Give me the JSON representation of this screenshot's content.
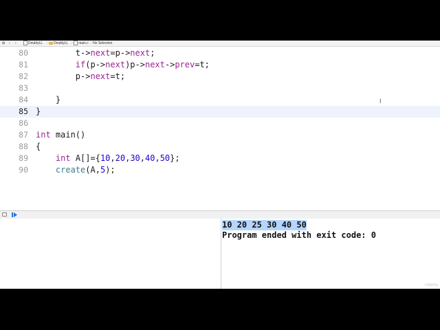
{
  "jumpbar": {
    "crumbs": [
      "DoublyLL",
      "DoublyLL",
      "main.c",
      "No Selection"
    ]
  },
  "editor": {
    "current_line": 85,
    "lines": [
      {
        "n": 80,
        "tokens": [
          [
            "plain",
            "        t->"
          ],
          [
            "kw",
            "next"
          ],
          [
            "plain",
            "=p->"
          ],
          [
            "kw",
            "next"
          ],
          [
            "plain",
            ";"
          ]
        ]
      },
      {
        "n": 81,
        "tokens": [
          [
            "plain",
            "        "
          ],
          [
            "kw",
            "if"
          ],
          [
            "plain",
            "(p->"
          ],
          [
            "kw",
            "next"
          ],
          [
            "plain",
            ")p->"
          ],
          [
            "kw",
            "next"
          ],
          [
            "plain",
            "->"
          ],
          [
            "kw",
            "prev"
          ],
          [
            "plain",
            "=t;"
          ]
        ]
      },
      {
        "n": 82,
        "tokens": [
          [
            "plain",
            "        p->"
          ],
          [
            "kw",
            "next"
          ],
          [
            "plain",
            "=t;"
          ]
        ]
      },
      {
        "n": 83,
        "tokens": []
      },
      {
        "n": 84,
        "tokens": [
          [
            "plain",
            "    }"
          ]
        ]
      },
      {
        "n": 85,
        "tokens": [
          [
            "plain",
            "}"
          ]
        ]
      },
      {
        "n": 86,
        "tokens": []
      },
      {
        "n": 87,
        "tokens": [
          [
            "kw",
            "int"
          ],
          [
            "plain",
            " main()"
          ]
        ]
      },
      {
        "n": 88,
        "tokens": [
          [
            "plain",
            "{"
          ]
        ]
      },
      {
        "n": 89,
        "tokens": [
          [
            "plain",
            "    "
          ],
          [
            "kw",
            "int"
          ],
          [
            "plain",
            " A[]={"
          ],
          [
            "num",
            "10"
          ],
          [
            "plain",
            ","
          ],
          [
            "num",
            "20"
          ],
          [
            "plain",
            ","
          ],
          [
            "num",
            "30"
          ],
          [
            "plain",
            ","
          ],
          [
            "num",
            "40"
          ],
          [
            "plain",
            ","
          ],
          [
            "num",
            "50"
          ],
          [
            "plain",
            "};"
          ]
        ]
      },
      {
        "n": 90,
        "tokens": [
          [
            "plain",
            "    "
          ],
          [
            "fn",
            "create"
          ],
          [
            "plain",
            "(A,"
          ],
          [
            "num",
            "5"
          ],
          [
            "plain",
            ");"
          ]
        ]
      }
    ]
  },
  "console": {
    "lines": [
      "10 20 25 30 40 50",
      "Program ended with exit code: 0"
    ]
  },
  "watermark": "Udemy",
  "colors": {
    "keyword": "#9b2393",
    "number": "#1c00cf",
    "function": "#3e7b8a",
    "selection": "#b4d5fe",
    "current_line": "#eef3fb",
    "debug_accent": "#1f74d8"
  },
  "icons": [
    "add-editor-icon",
    "back-chevron-icon",
    "forward-chevron-icon",
    "folder-icon",
    "file-c-icon",
    "hide-debug-area-icon",
    "continue-icon",
    "text-cursor-icon"
  ]
}
